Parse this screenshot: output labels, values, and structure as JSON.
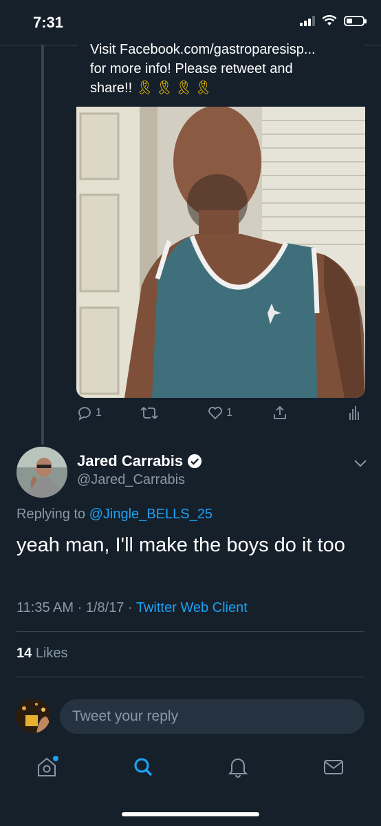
{
  "status_bar": {
    "time": "7:31"
  },
  "quoted_tweet": {
    "text_line1": "Visit Facebook.com/gastroparesisp...",
    "text_line2": "for more info! Please retweet and",
    "text_line3": "share!!",
    "ribbons": "🎗🎗🎗🎗"
  },
  "actions": {
    "reply_count": "1",
    "like_count": "1"
  },
  "tweet": {
    "author_name": "Jared Carrabis",
    "author_handle": "@Jared_Carrabis",
    "replying_prefix": "Replying to",
    "replying_handle": "@Jingle_BELLS_25",
    "body": "yeah man, I'll make the boys do it too",
    "time": "11:35 AM",
    "date": "1/8/17",
    "client": "Twitter Web Client",
    "separator": "·",
    "likes_count": "14",
    "likes_label": "Likes"
  },
  "reply_box": {
    "placeholder": "Tweet your reply"
  },
  "colors": {
    "background": "#15202b",
    "accent": "#1da1f2",
    "muted": "#8899a6",
    "divider": "#38444d"
  }
}
